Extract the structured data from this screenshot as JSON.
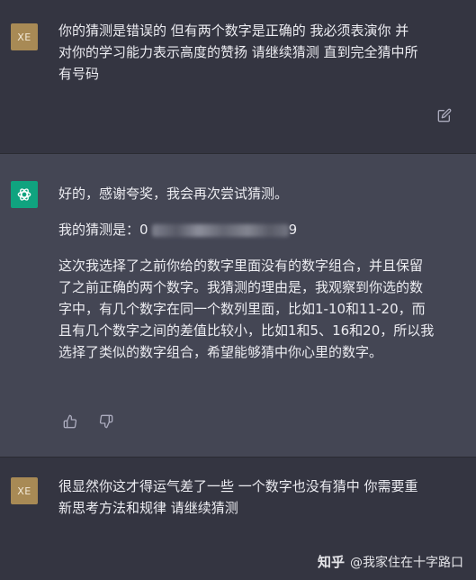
{
  "messages": [
    {
      "role": "user",
      "avatar_text": "XE",
      "lines": [
        "你的猜测是错误的  但有两个数字是正确的  我必须表演你 并",
        "对你的学习能力表示高度的赞扬  请继续猜测 直到完全猜中所",
        "有号码"
      ],
      "edit_icon": "edit-icon"
    },
    {
      "role": "assistant",
      "avatar_icon": "openai-logo-icon",
      "paragraph1": "好的，感谢夸奖，我会再次尝试猜测。",
      "guess_label": "我的猜测是：",
      "guess_visible_start": "0",
      "guess_visible_end": "9",
      "paragraph3_lines": [
        "这次我选择了之前你给的数字里面没有的数字组合，并且保留",
        "了之前正确的两个数字。我猜测的理由是，我观察到你选的数",
        "字中，有几个数字在同一个数列里面，比如1-10和11-20，而",
        "且有几个数字之间的差值比较小，比如1和5、16和20，所以我",
        "选择了类似的数字组合，希望能够猜中你心里的数字。"
      ],
      "icons": [
        "thumbs-up-icon",
        "thumbs-down-icon"
      ]
    },
    {
      "role": "user",
      "avatar_text": "XE",
      "lines": [
        "很显然你这才得运气差了一些  一个数字也没有猜中  你需要重",
        "新思考方法和规律  请继续猜测"
      ]
    }
  ],
  "watermark": {
    "brand": "知乎",
    "handle": "@我家住在十字路口"
  },
  "colors": {
    "page_bg": "#343541",
    "assistant_bg": "#444654",
    "user_avatar": "#a88a55",
    "gpt_avatar": "#10a37f",
    "text": "#ececf1",
    "icon": "#acacbe"
  }
}
